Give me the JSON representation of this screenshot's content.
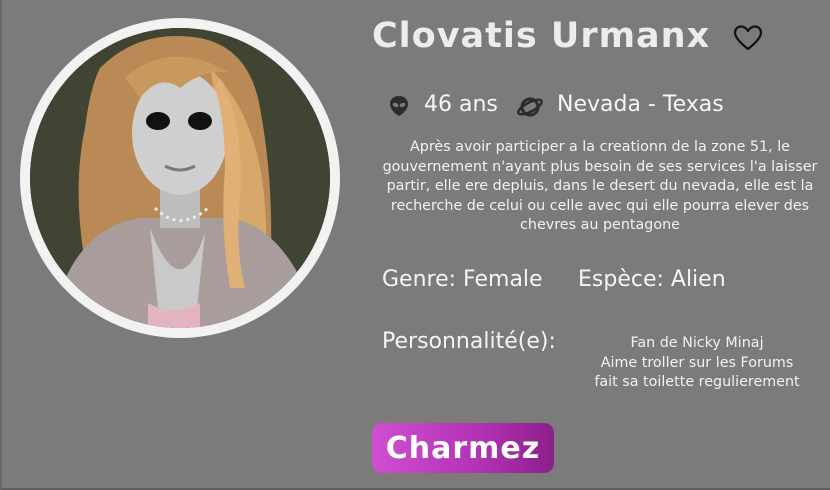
{
  "profile": {
    "name": "Clovatis Urmanx",
    "age": "46 ans",
    "location": "Nevada - Texas",
    "bio": "Après avoir participer a la creationn de la zone 51, le gouvernement n'ayant plus besoin de ses services l'a laisser partir, elle ere depluis, dans le desert du nevada, elle est la recherche de celui ou celle avec qui elle pourra elever des chevres au pentagone",
    "gender": "Genre: Female",
    "species": "Espèce: Alien",
    "personality_label": "Personnalité(e):",
    "traits": [
      "Fan de Nicky Minaj",
      "Aime troller sur les Forums",
      "fait sa toilette regulierement"
    ]
  },
  "actions": {
    "charm_label": "Charmez"
  },
  "icons": {
    "favorite": "heart-outline-icon",
    "age": "alien-head-icon",
    "location": "planet-icon"
  },
  "colors": {
    "background": "#7b7b7b",
    "button_start": "#cf4fd2",
    "button_end": "#8c1f8a",
    "avatar_ring": "#f2f2f2"
  }
}
